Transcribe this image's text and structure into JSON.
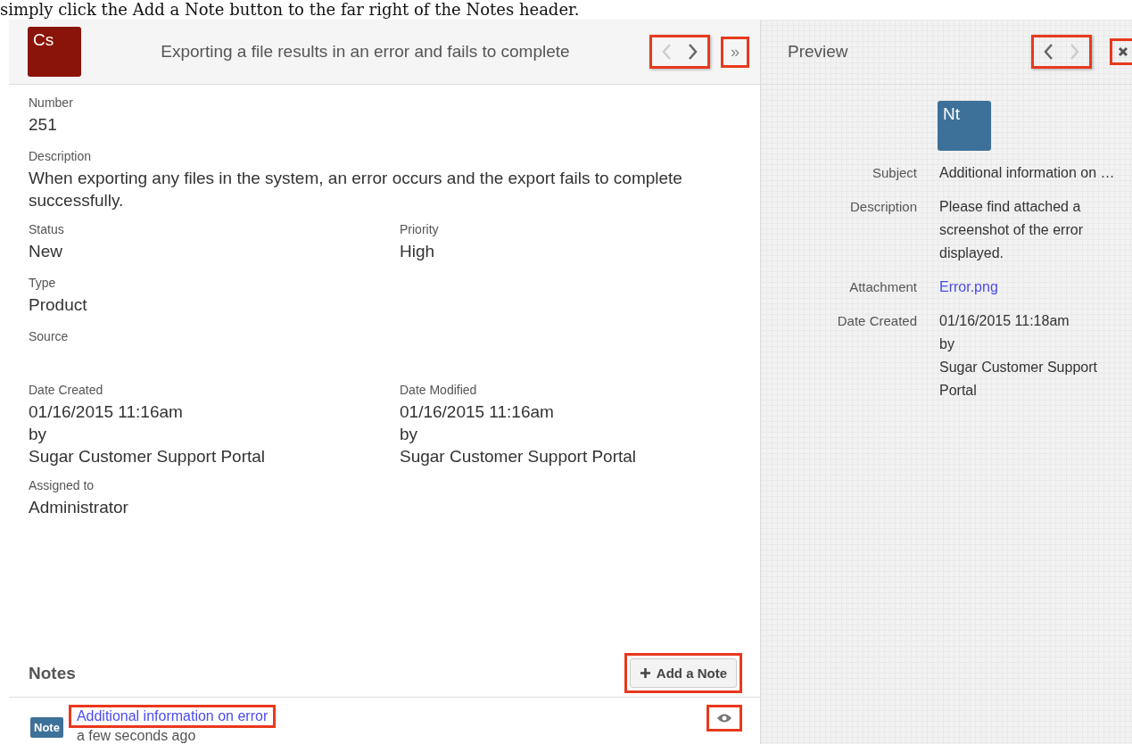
{
  "caption": "simply click the Add a Note button to the far right of the Notes header.",
  "record": {
    "avatar": "Cs",
    "title": "Exporting a file results in an error and fails to complete",
    "nav": {
      "prev_disabled": true,
      "next_disabled": false,
      "highlighted": true
    },
    "expand": {
      "label": "»",
      "highlighted": true
    }
  },
  "rows": [
    {
      "cells": [
        {
          "label": "Number",
          "lines": [
            "251"
          ]
        }
      ]
    },
    {
      "cells": [
        {
          "label": "Description",
          "lines": [
            "When exporting any files in the system, an error occurs and the export fails to complete successfully."
          ]
        }
      ]
    },
    {
      "cells": [
        {
          "label": "Status",
          "lines": [
            "New"
          ]
        },
        {
          "label": "Priority",
          "lines": [
            "High"
          ]
        }
      ]
    },
    {
      "cells": [
        {
          "label": "Type",
          "lines": [
            "Product"
          ]
        }
      ]
    },
    {
      "cells": [
        {
          "label": "Source"
        }
      ]
    },
    {
      "cells": [
        {
          "label": "Date Created",
          "lines": [
            "01/16/2015 11:16am",
            "by",
            "Sugar Customer Support Portal"
          ]
        },
        {
          "label": "Date Modified",
          "lines": [
            "01/16/2015 11:16am",
            "by",
            "Sugar Customer Support Portal"
          ]
        }
      ]
    },
    {
      "cells": [
        {
          "label": "Assigned to",
          "lines": [
            "Administrator"
          ]
        }
      ]
    }
  ],
  "notes": {
    "title": "Notes",
    "add_button": {
      "label": "Add a Note",
      "highlighted": true
    },
    "items": [
      {
        "badge": "Note",
        "title": "Additional information on error",
        "time": "a few seconds ago",
        "title_highlighted": true,
        "preview_highlighted": true
      }
    ]
  },
  "preview": {
    "title": "Preview",
    "nav": {
      "prev_disabled": false,
      "next_disabled": true,
      "highlighted": true
    },
    "close_highlighted": true,
    "avatar": "Nt",
    "fields": [
      {
        "label": "Subject",
        "lines": [
          "Additional information on …"
        ],
        "kind": "text"
      },
      {
        "label": "Description",
        "lines": [
          "Please find attached a",
          "screenshot of the error",
          "displayed."
        ],
        "kind": "text"
      },
      {
        "label": "Attachment",
        "lines": [
          "Error.png"
        ],
        "kind": "link"
      },
      {
        "label": "Date Created",
        "lines": [
          "01/16/2015 11:18am",
          "by",
          "Sugar Customer Support",
          "Portal"
        ],
        "kind": "text"
      }
    ]
  }
}
